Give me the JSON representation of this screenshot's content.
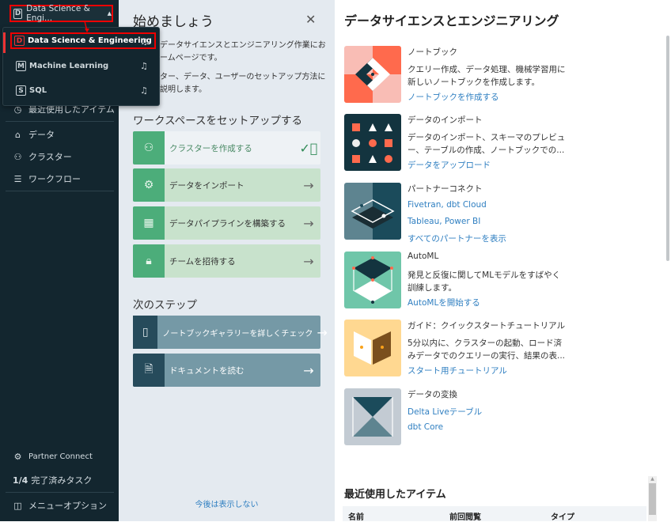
{
  "sidebar": {
    "workspace_switcher": {
      "label": "Data Science & Engi...",
      "letter": "D"
    },
    "personas": [
      {
        "letter": "D",
        "label": "Data Science & Engineering",
        "selected": true
      },
      {
        "letter": "M",
        "label": "Machine Learning"
      },
      {
        "letter": "S",
        "label": "SQL"
      }
    ],
    "items": [
      {
        "icon": "clock-icon",
        "label": "最近使用したアイテム"
      },
      {
        "icon": "data-icon",
        "label": "データ"
      },
      {
        "icon": "cluster-icon",
        "label": "クラスター"
      },
      {
        "icon": "workflow-icon",
        "label": "ワークフロー"
      }
    ],
    "bottom": {
      "partner_connect": "Partner Connect",
      "tasks_count": "1/4",
      "tasks_label": "完了済みタスク",
      "menu_options": "メニューオプション"
    }
  },
  "getting_started": {
    "title": "始めましょう",
    "desc1_line1": "データサイエンスとエンジニアリング作業にお",
    "desc1_line2": "ームページです。",
    "desc2_line1": "ター、データ、ユーザーのセットアップ方法に",
    "desc2_line2": "説明します。",
    "setup_heading": "ワークスペースをセットアップする",
    "setup_cards": [
      {
        "icon": "cluster-icon",
        "label": "クラスターを作成する",
        "done": true
      },
      {
        "icon": "gear-icon",
        "label": "データをインポート"
      },
      {
        "icon": "table-icon",
        "label": "データパイプラインを構築する"
      },
      {
        "icon": "lock-icon",
        "label": "チームを招待する"
      }
    ],
    "next_heading": "次のステップ",
    "next_cards": [
      {
        "icon": "notebook-icon",
        "label": "ノートブックギャラリーを詳しくチェック"
      },
      {
        "icon": "document-icon",
        "label": "ドキュメントを読む"
      }
    ],
    "dismiss": "今後は表示しない"
  },
  "main": {
    "title": "データサイエンスとエンジニアリング",
    "features": [
      {
        "title": "ノートブック",
        "desc": "クエリー作成、データ処理、機械学習用に新しいノートブックを作成します。",
        "links": [
          "ノートブックを作成する"
        ]
      },
      {
        "title": "データのインポート",
        "desc": "データのインポート、スキーマのプレビュー、テーブルの作成、ノートブックでの...",
        "links": [
          "データをアップロード"
        ]
      },
      {
        "title": "パートナーコネクト",
        "desc": "",
        "links": [
          "Fivetran, dbt Cloud",
          "Tableau, Power BI",
          "すべてのパートナーを表示"
        ]
      },
      {
        "title": "AutoML",
        "desc": "発見と反復に関してMLモデルをすばやく訓練します。",
        "links": [
          "AutoMLを開始する"
        ]
      },
      {
        "title": "ガイド：クイックスタートチュートリアル",
        "desc": "5分以内に、クラスターの起動、ロード済みデータでのクエリーの実行、結果の表...",
        "links": [
          "スタート用チュートリアル"
        ]
      },
      {
        "title": "データの変換",
        "desc": "",
        "links": [
          "Delta Liveテーブル",
          "dbt Core"
        ]
      }
    ],
    "recent": {
      "title": "最近使用したアイテム",
      "columns": [
        "名前",
        "前回閲覧",
        "タイプ"
      ]
    }
  },
  "colors": {
    "sidebar": "#13262f",
    "highlight": "#e00000",
    "green": "#4cad7a",
    "link": "#2f7fc1"
  }
}
